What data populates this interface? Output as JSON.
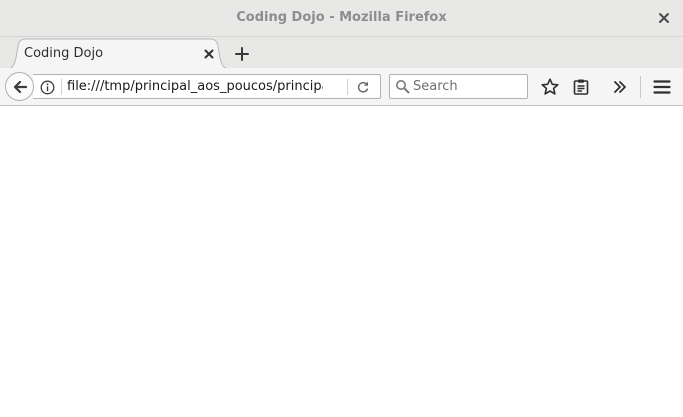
{
  "window": {
    "title": "Coding Dojo - Mozilla Firefox"
  },
  "tabs": [
    {
      "label": "Coding Dojo",
      "active": true
    }
  ],
  "navbar": {
    "url": "file:///tmp/principal_aos_poucos/principal.html",
    "search_placeholder": "Search"
  },
  "icons": {
    "close": "close-icon",
    "new_tab": "plus-icon",
    "back": "arrow-left-icon",
    "info": "info-icon",
    "reload": "reload-icon",
    "search": "magnifier-icon",
    "bookmark": "star-icon",
    "reader": "clipboard-icon",
    "overflow": "double-chevron-icon",
    "menu": "hamburger-icon"
  },
  "colors": {
    "chrome_bg": "#e8e8e7",
    "navbar_bg": "#f5f5f5",
    "title_text": "#8b8e8f",
    "content_bg": "#ffffff"
  }
}
